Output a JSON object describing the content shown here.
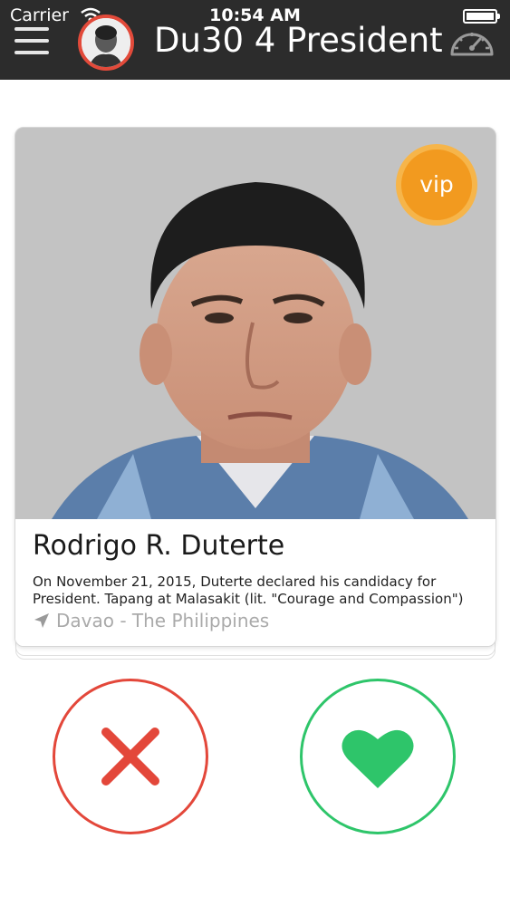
{
  "status_bar": {
    "carrier": "Carrier",
    "time": "10:54 AM"
  },
  "header": {
    "title": "Du30 4 President",
    "menu_icon": "hamburger-menu-icon",
    "avatar": "user-avatar",
    "right_icon": "speedometer-icon"
  },
  "card": {
    "badge": "vip",
    "name": "Rodrigo R. Duterte",
    "description": "On November 21, 2015, Duterte declared his candidacy for President. Tapang at Malasakit (lit. \"Courage and Compassion\")",
    "location": "Davao - The Philippines",
    "location_icon": "location-arrow-icon"
  },
  "actions": {
    "dislike_icon": "x-icon",
    "like_icon": "heart-icon"
  },
  "colors": {
    "header_bg": "#2c2c2c",
    "avatar_ring": "#e24a3a",
    "vip_badge": "#f29a1f",
    "dislike": "#e3473a",
    "like": "#2ec56a",
    "location_text": "#aaaaaa"
  }
}
